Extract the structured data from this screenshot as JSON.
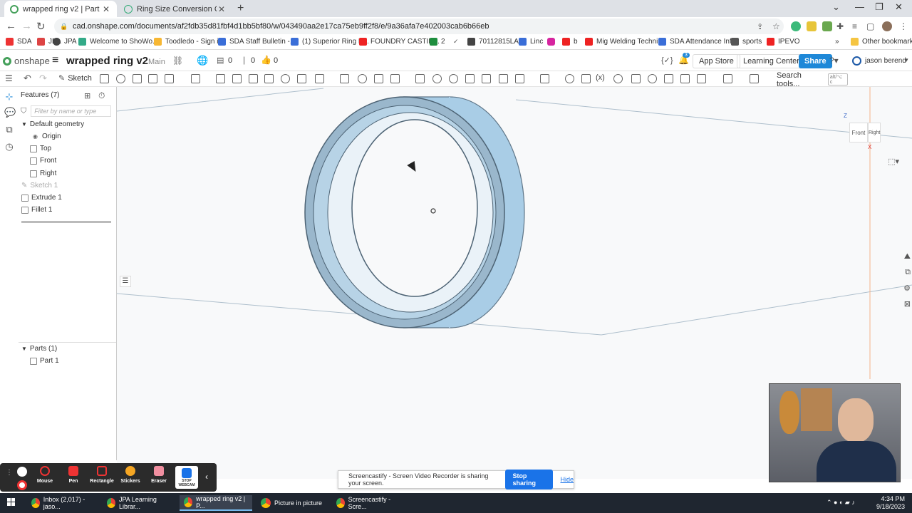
{
  "browser": {
    "tabs": [
      {
        "title": "wrapped ring v2 | Part Studio 1",
        "close": "✕"
      },
      {
        "title": "Ring Size Conversion Chart | 25K",
        "close": "✕"
      }
    ],
    "new_tab": "+",
    "url": "cad.onshape.com/documents/af2fdb35d81fbf4d1bb5bf80/w/043490aa2e17ca75eb9ff2f8/e/9a36afa7e402003cab6b66eb",
    "bookmarks": [
      "SDA",
      "JPA",
      "Welcome to ShoWo...",
      "Toodledo - Sign in",
      "SDA Staff Bulletin -...",
      "(1) Superior Ring B...",
      "FOUNDRY CASTIN...",
      "2",
      "70112815LA",
      "Linc",
      "b",
      "Mig Welding Techni...",
      "SDA Attendance Inf...",
      "sports",
      "IPEVO"
    ],
    "other_bookmarks": "Other bookmarks",
    "overflow": "»"
  },
  "onshape": {
    "logo": "onshape",
    "doc_title": "wrapped ring v2",
    "workspace": "Main",
    "count_versions": "0",
    "count_comments": "0",
    "count_likes": "0",
    "notif_badge": "3",
    "app_store": "App Store",
    "learning_center": "Learning Center",
    "share": "Share",
    "user": "jason berend",
    "sketch": "Sketch",
    "search_tools": "Search tools...",
    "search_kbd": "alt/⌥ c"
  },
  "features": {
    "header": "Features (7)",
    "filter_placeholder": "Filter by name or type",
    "default_geometry": "Default geometry",
    "items": [
      "Origin",
      "Top",
      "Front",
      "Right"
    ],
    "sketch1": "Sketch 1",
    "extrude1": "Extrude 1",
    "fillet1": "Fillet 1",
    "parts_header": "Parts (1)",
    "part1": "Part 1"
  },
  "viewcube": {
    "front": "Front",
    "right": "Right",
    "z": "Z",
    "x": "X"
  },
  "screencastify": {
    "tools": [
      "Mouse",
      "Pen",
      "Rectangle",
      "Stickers",
      "Eraser",
      "STOP WEBCAM"
    ],
    "banner": "Screencastify - Screen Video Recorder is sharing your screen.",
    "stop": "Stop sharing",
    "hide": "Hide"
  },
  "taskbar": {
    "tasks": [
      "Inbox (2,017) - jaso...",
      "JPA Learning Librar...",
      "wrapped ring v2 | P...",
      "Picture in picture",
      "Screencastify - Scre..."
    ],
    "time": "4:34 PM",
    "date": "9/18/2023"
  },
  "colors": {
    "accent": "#1e88d8",
    "ring": "#a9cde6",
    "ring_dark": "#6f8da3"
  }
}
